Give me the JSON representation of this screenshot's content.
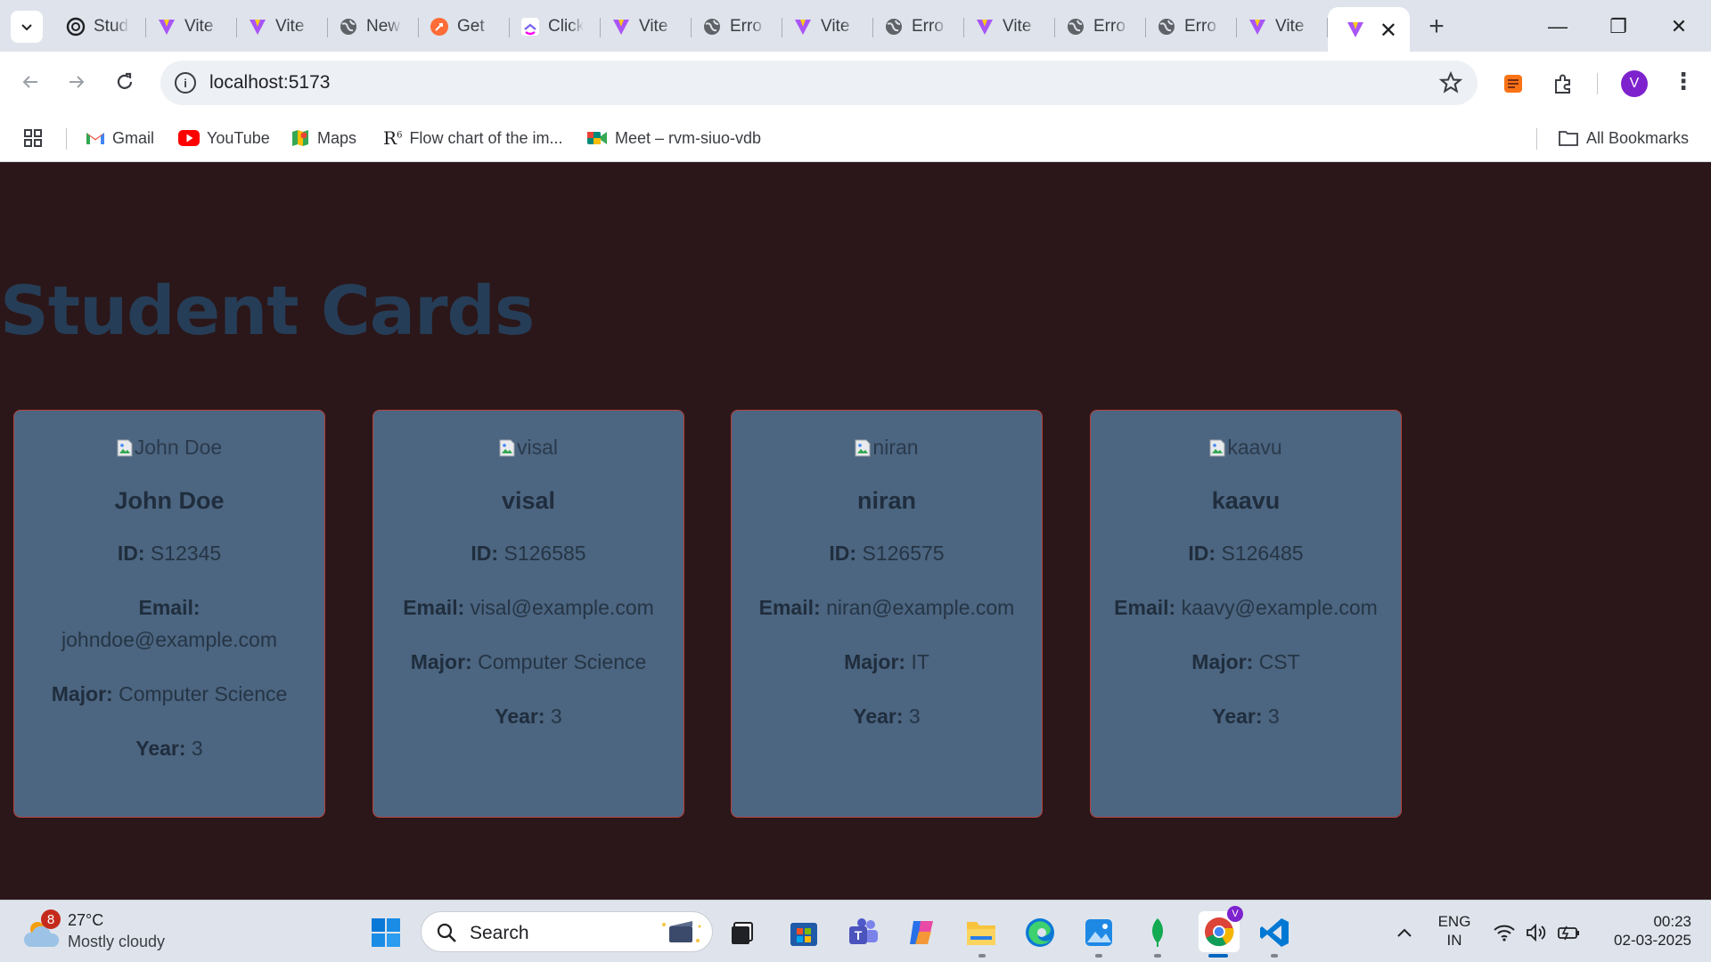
{
  "browser": {
    "tabs": [
      {
        "title": "Stud",
        "icon": "openai-icon"
      },
      {
        "title": "Vite",
        "icon": "vite-icon"
      },
      {
        "title": "Vite",
        "icon": "vite-icon"
      },
      {
        "title": "New",
        "icon": "globe-icon"
      },
      {
        "title": "Get",
        "icon": "postman-icon"
      },
      {
        "title": "Click",
        "icon": "clickup-icon"
      },
      {
        "title": "Vite",
        "icon": "vite-icon"
      },
      {
        "title": "Erro",
        "icon": "globe-icon"
      },
      {
        "title": "Vite",
        "icon": "vite-icon"
      },
      {
        "title": "Erro",
        "icon": "globe-icon"
      },
      {
        "title": "Vite",
        "icon": "vite-icon"
      },
      {
        "title": "Erro",
        "icon": "globe-icon"
      },
      {
        "title": "Erro",
        "icon": "globe-icon"
      },
      {
        "title": "Vite",
        "icon": "vite-icon"
      }
    ],
    "active_tab": {
      "icon": "vite-icon",
      "close": "✕"
    },
    "new_tab": "+",
    "window": {
      "minimize": "—",
      "restore": "❐",
      "close": "✕"
    },
    "url": "localhost:5173",
    "profile_initial": "V",
    "bookmarks": [
      {
        "label": "Gmail",
        "icon": "gmail-icon"
      },
      {
        "label": "YouTube",
        "icon": "youtube-icon"
      },
      {
        "label": "Maps",
        "icon": "maps-icon"
      },
      {
        "label": "Flow chart of the im...",
        "icon": "r-icon"
      },
      {
        "label": "Meet – rvm-siuo-vdb",
        "icon": "meet-icon"
      }
    ],
    "all_bookmarks": "All Bookmarks"
  },
  "page": {
    "title": "Student Cards",
    "labels": {
      "id": "ID:",
      "email": "Email:",
      "major": "Major:",
      "year": "Year:"
    },
    "students": [
      {
        "img_alt": "John Doe",
        "name": "John Doe",
        "id": "S12345",
        "email": "johndoe@example.com",
        "major": "Computer Science",
        "year": "3"
      },
      {
        "img_alt": "visal",
        "name": "visal",
        "id": "S126585",
        "email": "visal@example.com",
        "major": "Computer Science",
        "year": "3"
      },
      {
        "img_alt": "niran",
        "name": "niran",
        "id": "S126575",
        "email": "niran@example.com",
        "major": "IT",
        "year": "3"
      },
      {
        "img_alt": "kaavu",
        "name": "kaavu",
        "id": "S126485",
        "email": "kaavy@example.com",
        "major": "CST",
        "year": "3"
      }
    ]
  },
  "taskbar": {
    "weather": {
      "temp": "27°C",
      "condition": "Mostly cloudy",
      "badge": "8"
    },
    "search_label": "Search",
    "language": {
      "line1": "ENG",
      "line2": "IN"
    },
    "time": "00:23",
    "date": "02-03-2025"
  },
  "colors": {
    "page_bg": "#2b1719",
    "card_bg": "#4c6580",
    "card_border": "#b7413d",
    "title": "#263d57"
  }
}
